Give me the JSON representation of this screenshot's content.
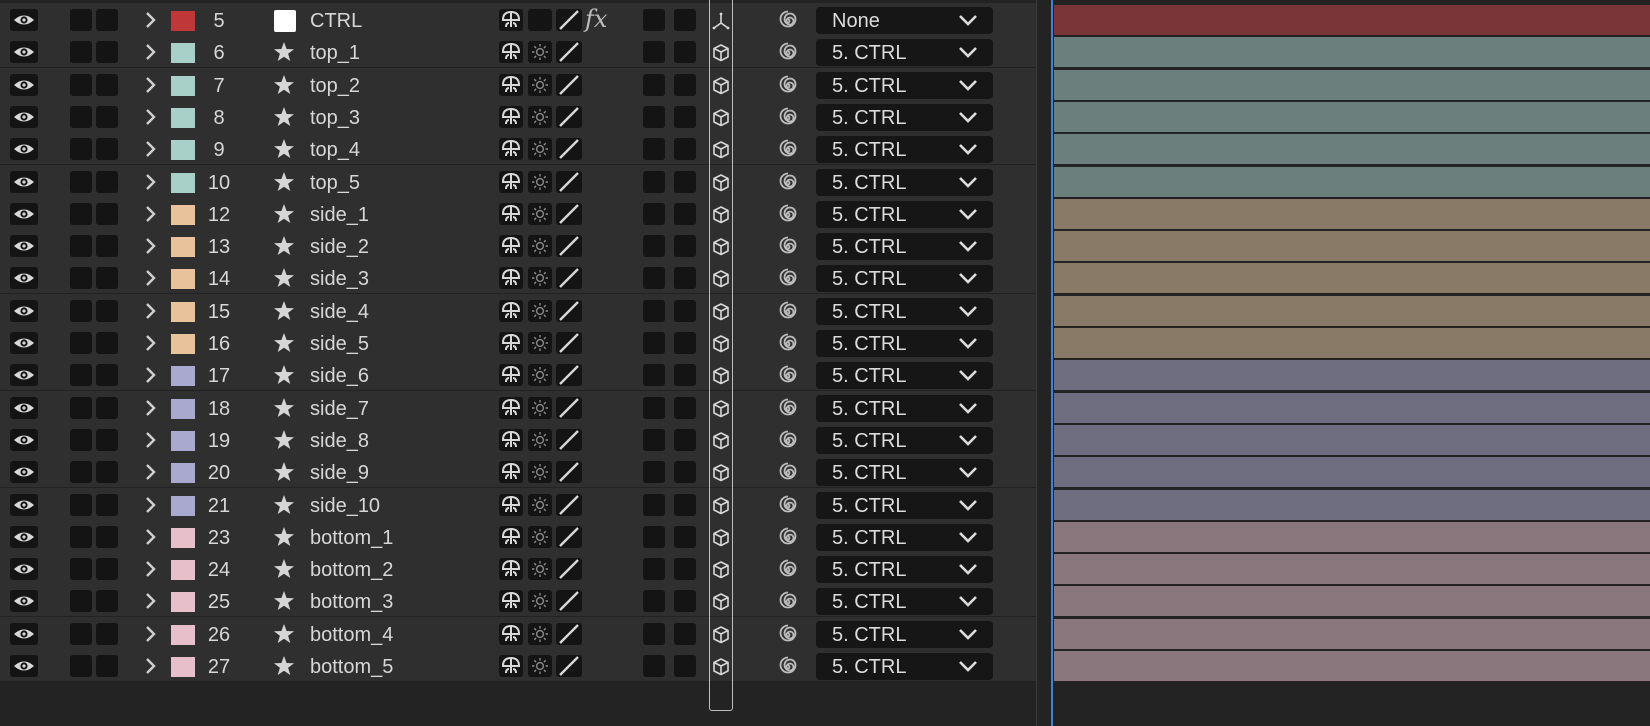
{
  "colors": {
    "panel": "#2f2f2f",
    "background": "#232323",
    "time_indicator": "#3a83d6"
  },
  "layers": [
    {
      "num": "5",
      "name": "CTRL",
      "label_color": "#c0373a",
      "type": "null",
      "parent": "None",
      "bar_color": "#7a3538",
      "fx": "fx"
    },
    {
      "num": "6",
      "name": "top_1",
      "label_color": "#a8cfc8",
      "type": "shape",
      "parent": "5. CTRL",
      "bar_color": "#6b807d"
    },
    {
      "num": "7",
      "name": "top_2",
      "label_color": "#a8cfc8",
      "type": "shape",
      "parent": "5. CTRL",
      "bar_color": "#6b807d"
    },
    {
      "num": "8",
      "name": "top_3",
      "label_color": "#a8cfc8",
      "type": "shape",
      "parent": "5. CTRL",
      "bar_color": "#6b807d"
    },
    {
      "num": "9",
      "name": "top_4",
      "label_color": "#a8cfc8",
      "type": "shape",
      "parent": "5. CTRL",
      "bar_color": "#6b807d"
    },
    {
      "num": "10",
      "name": "top_5",
      "label_color": "#a8cfc8",
      "type": "shape",
      "parent": "5. CTRL",
      "bar_color": "#6b807d",
      "group_end": true
    },
    {
      "num": "12",
      "name": "side_1",
      "label_color": "#e8c29a",
      "type": "shape",
      "parent": "5. CTRL",
      "bar_color": "#897a68"
    },
    {
      "num": "13",
      "name": "side_2",
      "label_color": "#e8c29a",
      "type": "shape",
      "parent": "5. CTRL",
      "bar_color": "#897a68"
    },
    {
      "num": "14",
      "name": "side_3",
      "label_color": "#e8c29a",
      "type": "shape",
      "parent": "5. CTRL",
      "bar_color": "#897a68"
    },
    {
      "num": "15",
      "name": "side_4",
      "label_color": "#e8c29a",
      "type": "shape",
      "parent": "5. CTRL",
      "bar_color": "#897a68"
    },
    {
      "num": "16",
      "name": "side_5",
      "label_color": "#e8c29a",
      "type": "shape",
      "parent": "5. CTRL",
      "bar_color": "#897a68"
    },
    {
      "num": "17",
      "name": "side_6",
      "label_color": "#a9a9d0",
      "type": "shape",
      "parent": "5. CTRL",
      "bar_color": "#6e6e80"
    },
    {
      "num": "18",
      "name": "side_7",
      "label_color": "#a9a9d0",
      "type": "shape",
      "parent": "5. CTRL",
      "bar_color": "#6e6e80"
    },
    {
      "num": "19",
      "name": "side_8",
      "label_color": "#a9a9d0",
      "type": "shape",
      "parent": "5. CTRL",
      "bar_color": "#6e6e80"
    },
    {
      "num": "20",
      "name": "side_9",
      "label_color": "#a9a9d0",
      "type": "shape",
      "parent": "5. CTRL",
      "bar_color": "#6e6e80"
    },
    {
      "num": "21",
      "name": "side_10",
      "label_color": "#a9a9d0",
      "type": "shape",
      "parent": "5. CTRL",
      "bar_color": "#6e6e80",
      "group_end": true
    },
    {
      "num": "23",
      "name": "bottom_1",
      "label_color": "#e6bfcb",
      "type": "shape",
      "parent": "5. CTRL",
      "bar_color": "#8a777d"
    },
    {
      "num": "24",
      "name": "bottom_2",
      "label_color": "#e6bfcb",
      "type": "shape",
      "parent": "5. CTRL",
      "bar_color": "#8a777d"
    },
    {
      "num": "25",
      "name": "bottom_3",
      "label_color": "#e6bfcb",
      "type": "shape",
      "parent": "5. CTRL",
      "bar_color": "#8a777d"
    },
    {
      "num": "26",
      "name": "bottom_4",
      "label_color": "#e6bfcb",
      "type": "shape",
      "parent": "5. CTRL",
      "bar_color": "#8a777d"
    },
    {
      "num": "27",
      "name": "bottom_5",
      "label_color": "#e6bfcb",
      "type": "shape",
      "parent": "5. CTRL",
      "bar_color": "#8a777d"
    }
  ],
  "icons": {
    "visibility": "eye-icon",
    "twirl": "chevron-right-icon",
    "shape_layer": "star-icon",
    "null_layer": "white-square-icon",
    "shy": "shy-icon",
    "collapse": "sun-icon",
    "quality": "slash-icon",
    "effects": "fx-icon",
    "three_d": "cube-icon",
    "null_3d": "axis-icon",
    "pick_whip": "spiral-icon",
    "dropdown": "chevron-down-icon"
  }
}
